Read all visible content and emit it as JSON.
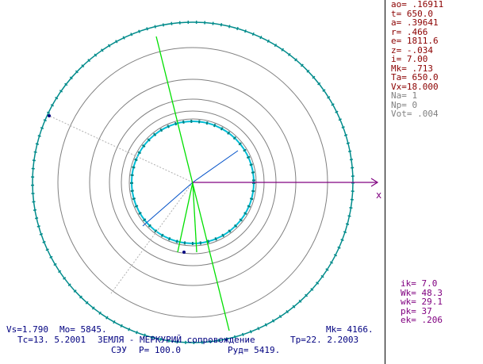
{
  "params": [
    {
      "text": "ao= .16911",
      "color": "#8b0000"
    },
    {
      "text": "t= 650.0",
      "color": "#8b0000"
    },
    {
      "text": "a= .39641",
      "color": "#8b0000"
    },
    {
      "text": "r= .466",
      "color": "#8b0000"
    },
    {
      "text": "e= 1811.6",
      "color": "#8b0000"
    },
    {
      "text": "z= -.034",
      "color": "#8b0000"
    },
    {
      "text": "i= 7.00",
      "color": "#8b0000"
    },
    {
      "text": "Mk= .713",
      "color": "#8b0000"
    },
    {
      "text": "Ta= 650.0",
      "color": "#8b0000"
    },
    {
      "text": "Vx=18.000",
      "color": "#8b0000"
    },
    {
      "text": "Na= 1",
      "color": "#808080"
    },
    {
      "text": "Np= 0",
      "color": "#808080"
    },
    {
      "text": "Vot= .004",
      "color": "#808080"
    }
  ],
  "params_bottom": [
    {
      "text": "ik= 7.0",
      "color": "#800080"
    },
    {
      "text": "Wk= 48.3",
      "color": "#800080"
    },
    {
      "text": "wk= 29.1",
      "color": "#800080"
    },
    {
      "text": "pk= 37",
      "color": "#800080"
    },
    {
      "text": "ek= .206",
      "color": "#800080"
    }
  ],
  "axis_label": "x",
  "status": {
    "vs": "Vs=1.790",
    "mo": "Mo= 5845.",
    "mk": "Mk= 4166.",
    "tc": "Tc=13. 5.2001",
    "mission": "ЗЕМЛЯ - МЕРКУРИЙ сопровождение",
    "tp": "Tp=22. 2.2003",
    "seu": "СЭУ",
    "p": "P= 100.0",
    "rud": "Руд= 5419."
  },
  "colors": {
    "outer_orbit": "#008080",
    "inner_orbit": "#00bcd4",
    "orbits": "#808080",
    "green_line": "#00ff00",
    "blue_line": "#0000ff",
    "axis": "#800080",
    "text": "#000080"
  }
}
